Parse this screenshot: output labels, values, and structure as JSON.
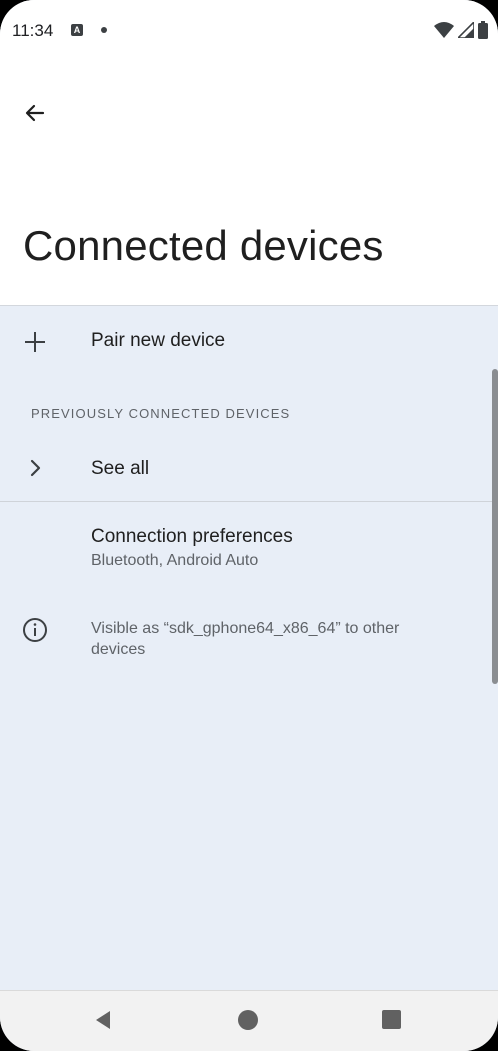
{
  "status_bar": {
    "time": "11:34",
    "notification_icon": "a-icon",
    "wifi_icon": "wifi-icon",
    "signal_icon": "signal-icon",
    "battery_icon": "battery-icon"
  },
  "header": {
    "back_icon": "arrow-back-icon",
    "title": "Connected devices"
  },
  "pair_new_device": {
    "icon": "plus-icon",
    "label": "Pair new device"
  },
  "previously_connected": {
    "header": "PREVIOUSLY CONNECTED DEVICES",
    "see_all_icon": "chevron-right-icon",
    "see_all_label": "See all"
  },
  "connection_preferences": {
    "title": "Connection preferences",
    "subtitle": "Bluetooth, Android Auto"
  },
  "visibility_info": {
    "icon": "info-icon",
    "text": "Visible as “sdk_gphone64_x86_64” to other devices"
  },
  "nav_bar": {
    "back_icon": "nav-back-icon",
    "home_icon": "nav-home-icon",
    "recents_icon": "nav-recents-icon"
  },
  "colors": {
    "background": "#e8eef7",
    "header_background": "#ffffff",
    "text_primary": "#1f1f1f",
    "text_secondary": "#5f6368"
  }
}
